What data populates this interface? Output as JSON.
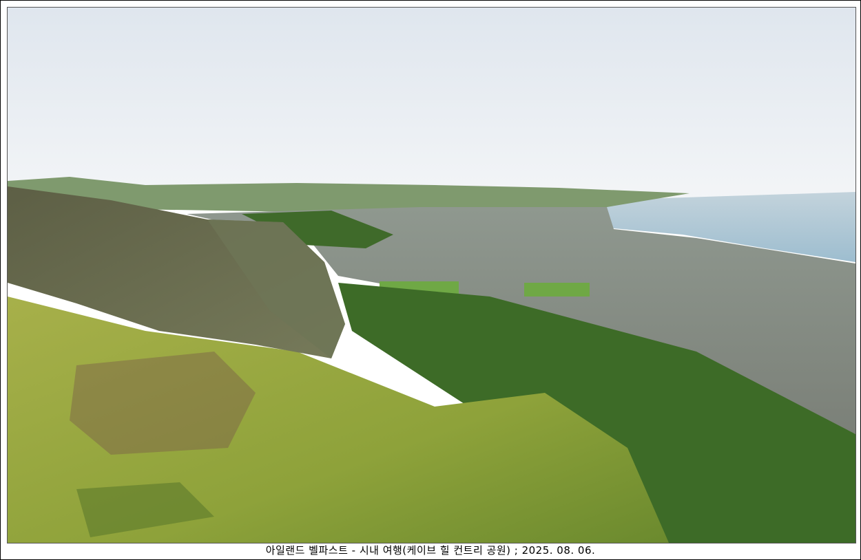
{
  "caption": "아일랜드 벨파스트 - 시내 여행(케이브 힐 컨트리 공원) ; 2025. 08. 06.",
  "colors": {
    "sky": "#e9eef3",
    "sea": "#a9c4d4",
    "grass": "#9fae3a",
    "forest": "#3f6e2a",
    "town": "#8a8f8a"
  }
}
